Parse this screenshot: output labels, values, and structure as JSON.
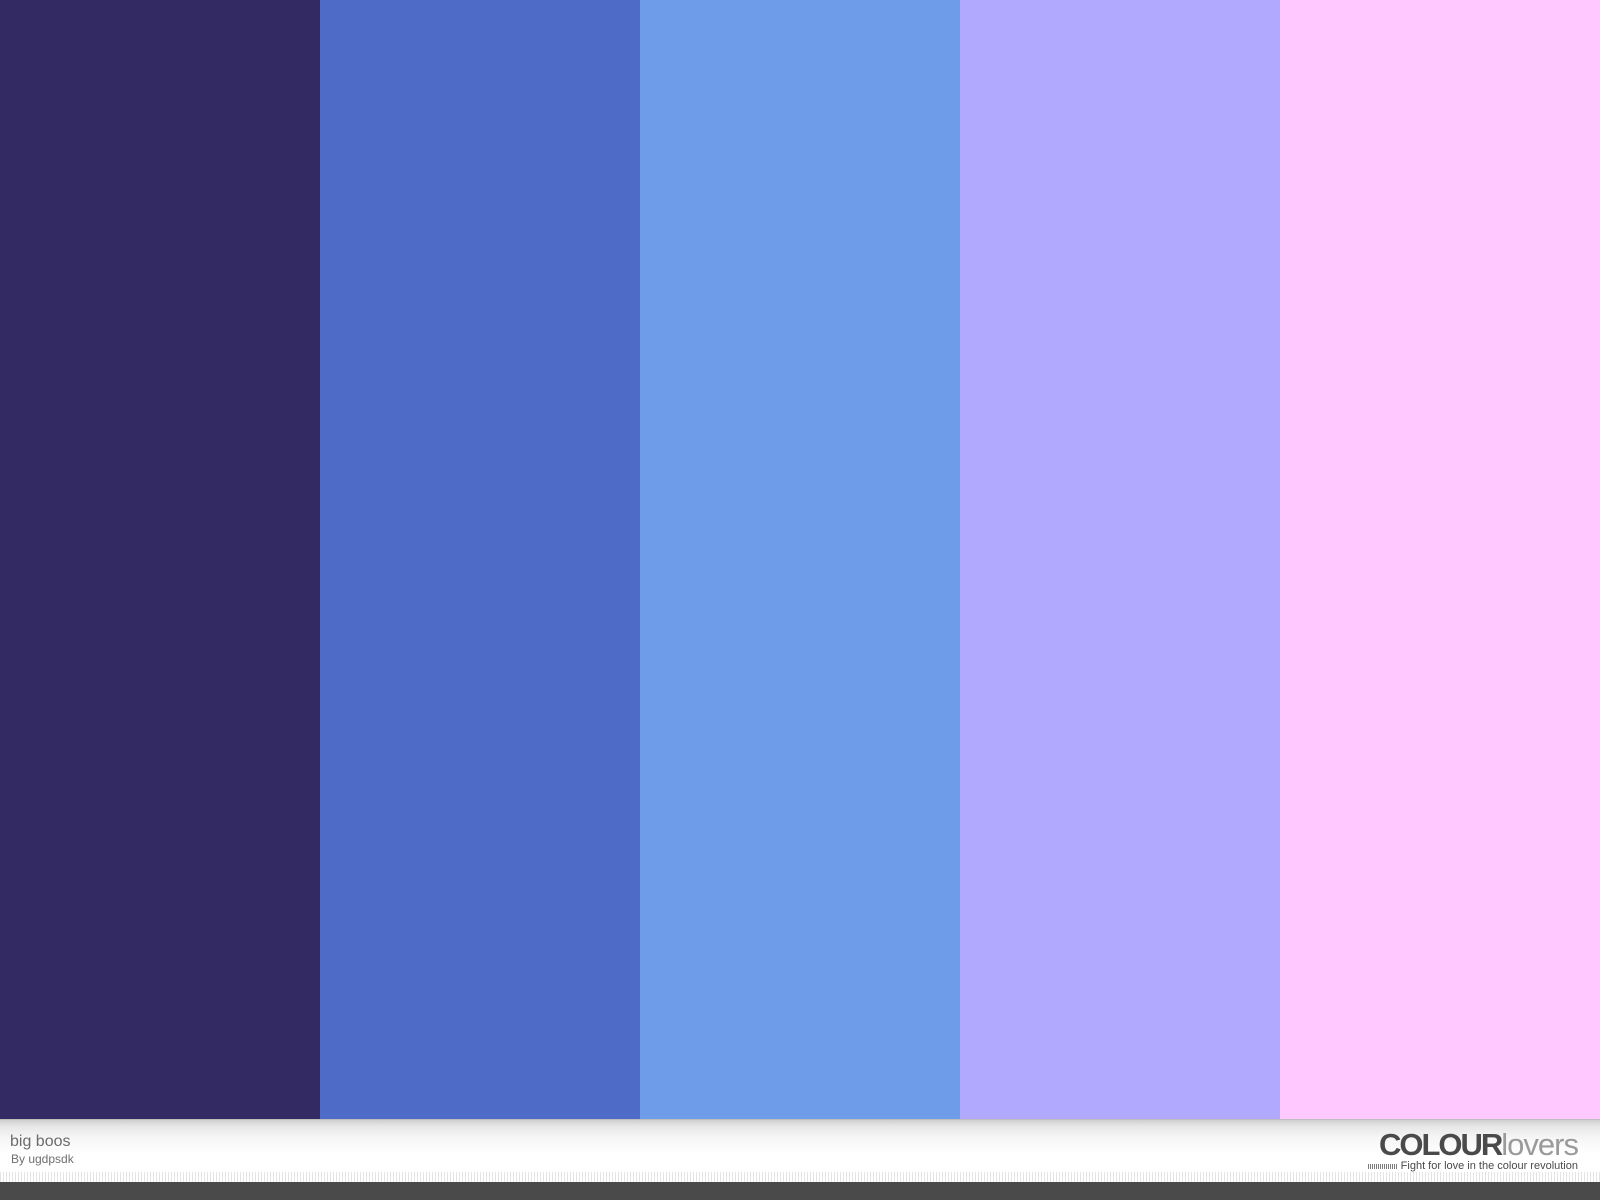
{
  "palette": {
    "title": "big boos",
    "author": "By ugdpsdk",
    "colors": [
      "#342A63",
      "#4E6BC8",
      "#6E9CE8",
      "#B1A9FE",
      "#FFC8FE"
    ]
  },
  "branding": {
    "logo_strong": "COLOUR",
    "logo_light": "lovers",
    "tagline": "Fight for love in the colour revolution"
  }
}
